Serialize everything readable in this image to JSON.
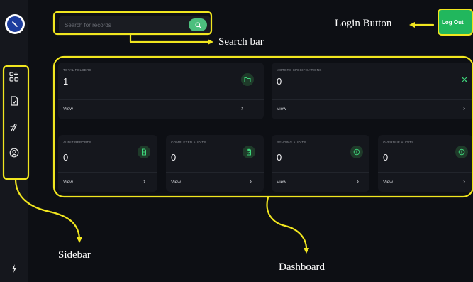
{
  "search": {
    "placeholder": "Search for records"
  },
  "header": {
    "logout_label": "Log Out"
  },
  "cards": [
    {
      "label": "TOTAL FOLDERS",
      "value": "1",
      "view": "View",
      "icon": "folder-icon"
    },
    {
      "label": "MOTORS SPECIFICATIONS",
      "value": "0",
      "view": "View",
      "icon": "tools-icon"
    },
    {
      "label": "AUDIT REPORTS",
      "value": "0",
      "view": "View",
      "icon": "document-icon"
    },
    {
      "label": "COMPLETED AUDITS",
      "value": "0",
      "view": "View",
      "icon": "clipboard-check-icon"
    },
    {
      "label": "PENDING AUDITS",
      "value": "0",
      "view": "View",
      "icon": "alert-circle-icon"
    },
    {
      "label": "OVERDUE AUDITS",
      "value": "0",
      "view": "View",
      "icon": "alert-circle-icon"
    }
  ],
  "annotations": {
    "login": "Login Button",
    "search": "Search bar",
    "sidebar": "Sidebar",
    "dashboard": "Dashboard"
  },
  "colors": {
    "accent_green": "#21b75d",
    "annotation_yellow": "#f1e61f",
    "background": "#0d0f14"
  }
}
